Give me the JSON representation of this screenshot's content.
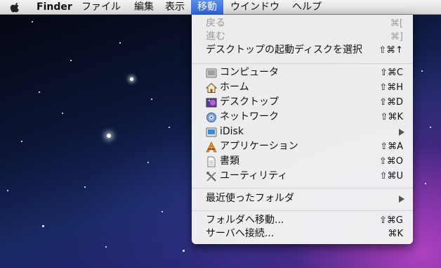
{
  "menubar": {
    "app_name": "Finder",
    "items": [
      "ファイル",
      "編集",
      "表示",
      "移動",
      "ウインドウ",
      "ヘルプ"
    ]
  },
  "go_menu": {
    "back": {
      "label": "戻る",
      "shortcut": "⌘["
    },
    "forward": {
      "label": "進む",
      "shortcut": "⌘]"
    },
    "startup_disk": {
      "label": "デスクトップの起動ディスクを選択",
      "shortcut": "⇧⌘↑"
    },
    "computer": {
      "label": "コンピュータ",
      "shortcut": "⇧⌘C",
      "icon": "computer-icon"
    },
    "home": {
      "label": "ホーム",
      "shortcut": "⇧⌘H",
      "icon": "home-icon"
    },
    "desktop": {
      "label": "デスクトップ",
      "shortcut": "⇧⌘D",
      "icon": "desktop-icon"
    },
    "network": {
      "label": "ネットワーク",
      "shortcut": "⇧⌘K",
      "icon": "network-icon"
    },
    "idisk": {
      "label": "iDisk",
      "icon": "idisk-icon"
    },
    "applications": {
      "label": "アプリケーション",
      "shortcut": "⇧⌘A",
      "icon": "applications-icon"
    },
    "documents": {
      "label": "書類",
      "shortcut": "⇧⌘O",
      "icon": "documents-icon"
    },
    "utilities": {
      "label": "ユーティリティ",
      "shortcut": "⇧⌘U",
      "icon": "utilities-icon"
    },
    "recent_folders": {
      "label": "最近使ったフォルダ"
    },
    "go_to_folder": {
      "label": "フォルダへ移動...",
      "shortcut": "⇧⌘G"
    },
    "connect_server": {
      "label": "サーバへ接続...",
      "shortcut": "⌘K"
    }
  },
  "colors": {
    "menu_highlight": "#3a6fe0"
  }
}
